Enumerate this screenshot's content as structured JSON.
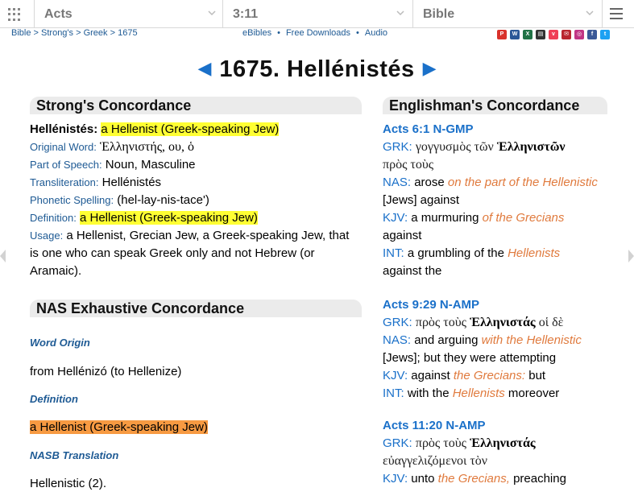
{
  "topbar": {
    "book": "Acts",
    "chapter_verse": "3:11",
    "version": "Bible"
  },
  "breadcrumb": {
    "bible": "Bible",
    "strongs": "Strong's",
    "greek": "Greek",
    "number": "1675"
  },
  "midlinks": {
    "ebibles": "eBibles",
    "downloads": "Free Downloads",
    "audio": "Audio"
  },
  "social_icons": [
    "pdf-icon",
    "word-icon",
    "excel-icon",
    "print-icon",
    "pocket-icon",
    "mail-icon",
    "instagram-icon",
    "facebook-icon",
    "twitter-icon"
  ],
  "title": "1675. Hellénistés",
  "strongs": {
    "heading": "Strong's Concordance",
    "headword": "Hellénistés:",
    "headword_def": "a Hellenist (Greek-speaking Jew)",
    "original_word_label": "Original Word:",
    "original_word": "Ἑλληνιστής, ου, ὁ",
    "pos_label": "Part of Speech:",
    "pos": "Noun, Masculine",
    "translit_label": "Transliteration:",
    "translit": "Hellénistés",
    "phonetic_label": "Phonetic Spelling:",
    "phonetic": "(hel-lay-nis-tace')",
    "definition_label": "Definition:",
    "definition": "a Hellenist (Greek-speaking Jew)",
    "usage_label": "Usage:",
    "usage_line1": "a Hellenist, Grecian Jew, a Greek-speaking Jew, that",
    "usage_line2": "is one who can speak Greek only and not Hebrew (or",
    "usage_line3": "Aramaic)."
  },
  "nas": {
    "heading": "NAS Exhaustive Concordance",
    "origin_label": "Word Origin",
    "origin": "from Hellénizó (to Hellenize)",
    "definition_label": "Definition",
    "definition": "a Hellenist (Greek-speaking Jew)",
    "translation_label": "NASB Translation",
    "translation": "Hellenistic (2)."
  },
  "englishman": {
    "heading": "Englishman's Concordance",
    "entries": [
      {
        "ref": "Acts 6:1 N-GMP",
        "grk_label": "GRK:",
        "grk_a": "γογγυσμὸς τῶν",
        "grk_b": "Ἑλληνιστῶν",
        "grk_c": "πρὸς τοὺς",
        "nas_label": "NAS:",
        "nas_a": "arose",
        "nas_b": "on the part of the Hellenistic",
        "nas_c": "[Jews] against",
        "kjv_label": "KJV:",
        "kjv_a": "a murmuring",
        "kjv_b": "of the Grecians",
        "kjv_c": "against",
        "int_label": "INT:",
        "int_a": "a grumbling of the",
        "int_b": "Hellenists",
        "int_c": "against the"
      },
      {
        "ref": "Acts 9:29 N-AMP",
        "grk_label": "GRK:",
        "grk_a": "πρὸς τοὺς",
        "grk_b": "Ἑλληνιστάς",
        "grk_c": "οἱ δὲ",
        "nas_label": "NAS:",
        "nas_a": "and arguing",
        "nas_b": "with the Hellenistic",
        "nas_c": "[Jews]; but they were attempting",
        "kjv_label": "KJV:",
        "kjv_a": "against",
        "kjv_b": "the Grecians:",
        "kjv_c": "but",
        "int_label": "INT:",
        "int_a": "with the",
        "int_b": "Hellenists",
        "int_c": "moreover"
      },
      {
        "ref": "Acts 11:20 N-AMP",
        "grk_label": "GRK:",
        "grk_a": "πρὸς τοὺς",
        "grk_b": "Ἑλληνιστάς",
        "grk_c": "εὐαγγελιζόμενοι τὸν",
        "kjv_label": "KJV:",
        "kjv_a": "unto",
        "kjv_b": "the Grecians,",
        "kjv_c": "preaching"
      }
    ]
  },
  "colors": {
    "link_blue": "#1e5a94",
    "accent_blue": "#1a70c9",
    "highlight_yellow": "#ffff33",
    "highlight_orange": "#f79a42",
    "italic_orange": "#e07a3d"
  }
}
